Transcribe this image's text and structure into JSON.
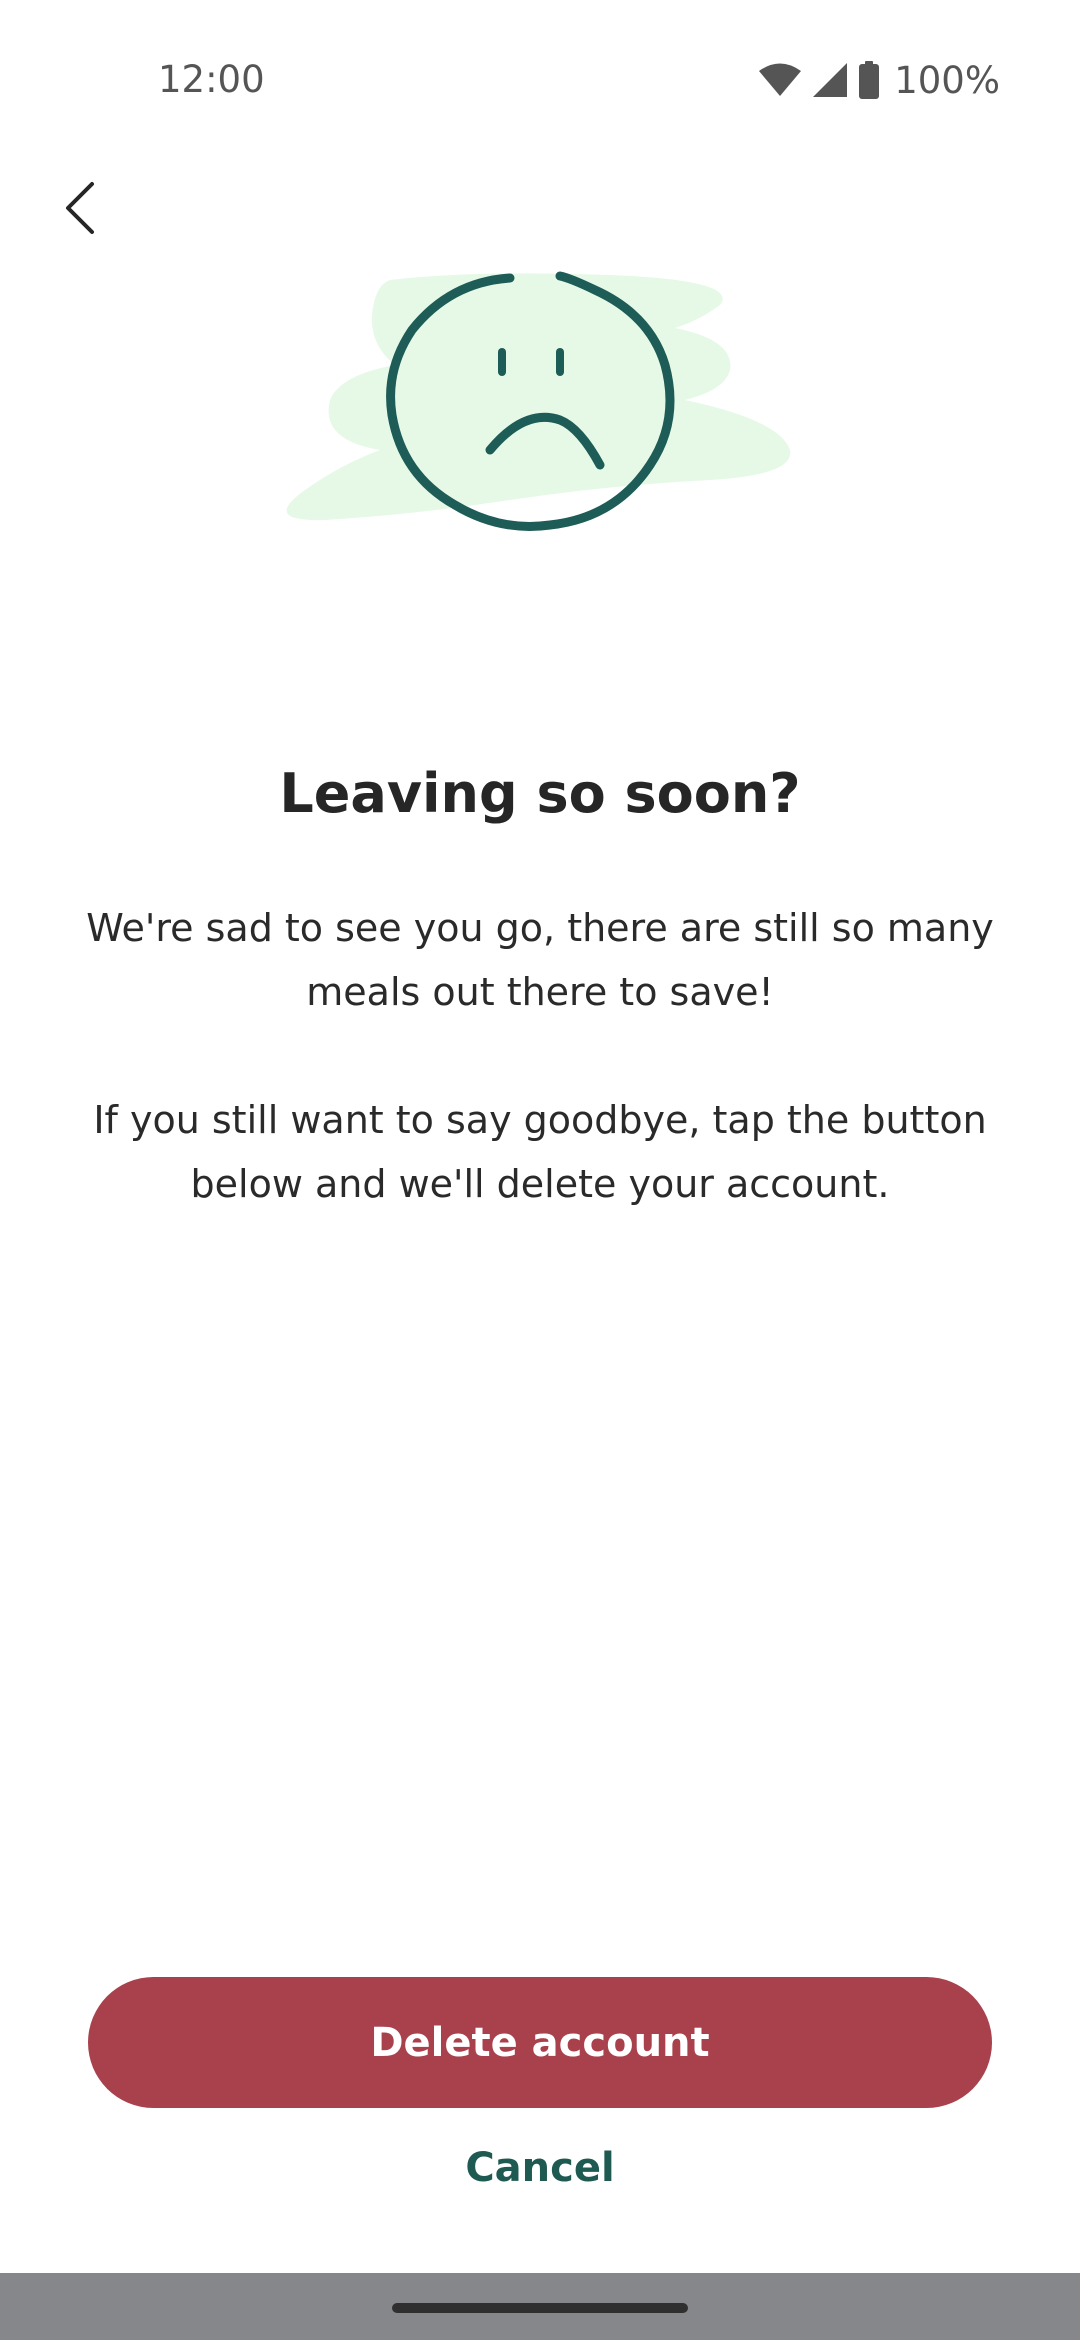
{
  "status_bar": {
    "time": "12:00",
    "battery": "100%",
    "icons": [
      "wifi-icon",
      "signal-icon",
      "battery-icon"
    ]
  },
  "header": {
    "back_icon": "back-arrow-icon"
  },
  "illustration": {
    "name": "sad-face-icon",
    "blob_color": "#e6f9e6",
    "line_color": "#1e5c57"
  },
  "content": {
    "title": "Leaving so soon?",
    "paragraph1": "We're sad to see you go, there are still so many meals out there to save!",
    "paragraph2": "If you still want to say goodbye, tap the button below and we'll delete your account."
  },
  "actions": {
    "delete_label": "Delete account",
    "cancel_label": "Cancel"
  },
  "colors": {
    "danger": "#a8414c",
    "accent": "#1f5a52",
    "nav_bar": "#86878a"
  }
}
